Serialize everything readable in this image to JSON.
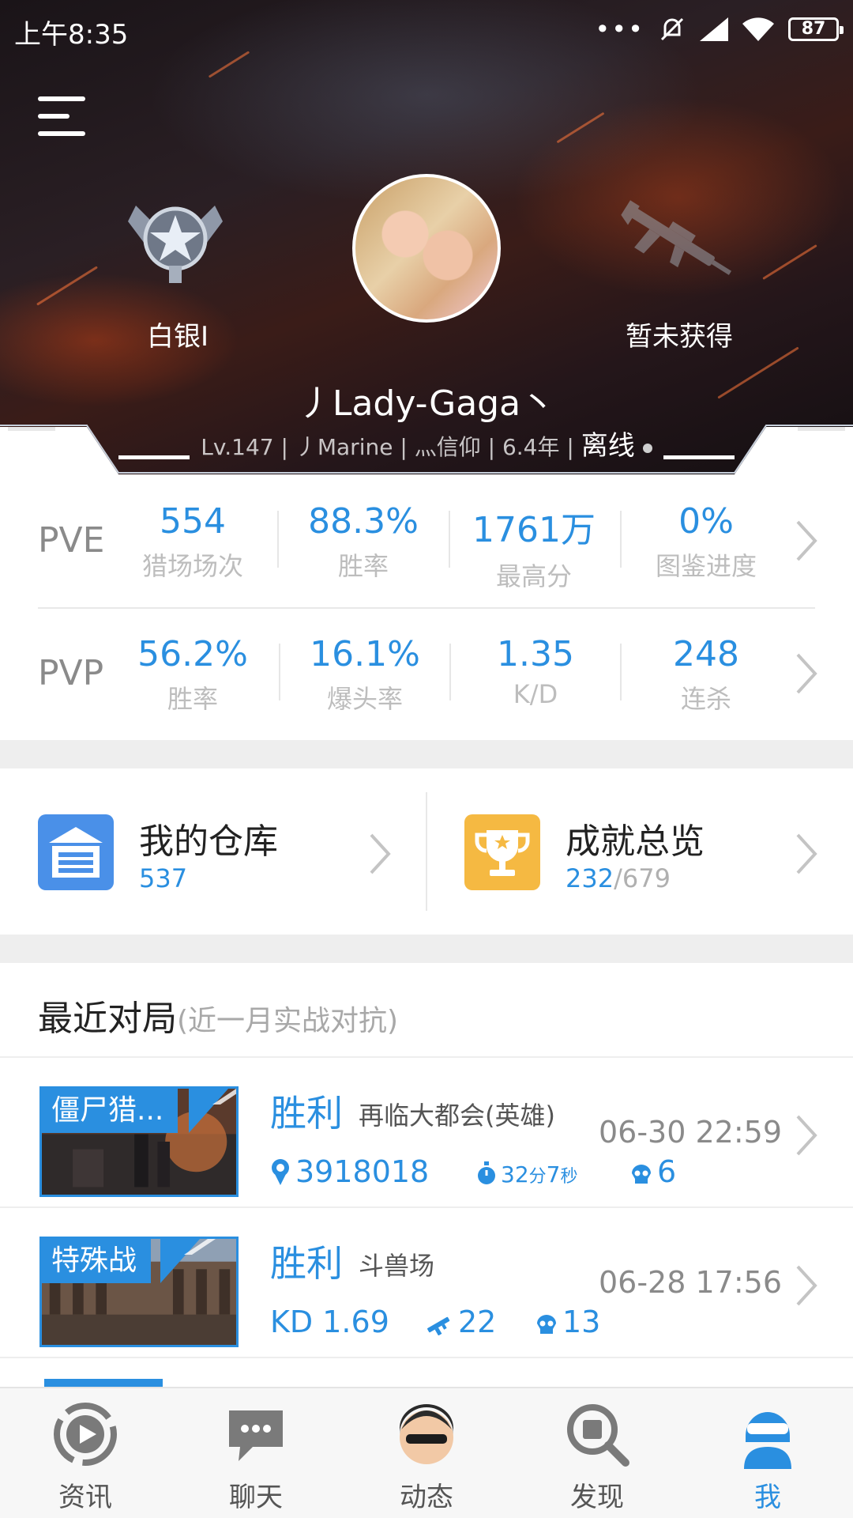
{
  "status_bar": {
    "time": "上午8:35",
    "battery": "87"
  },
  "profile": {
    "rank_label": "白银I",
    "weapon_label": "暂未获得",
    "nickname": "丿Lady-Gaga丶",
    "info": {
      "level": "Lv.147",
      "tag": "丿Marine",
      "clan": "灬信仰",
      "years": "6.4年",
      "status": "离线"
    }
  },
  "stats": {
    "pve": {
      "mode": "PVE",
      "items": [
        {
          "value": "554",
          "label": "猎场场次"
        },
        {
          "value": "88.3%",
          "label": "胜率"
        },
        {
          "value": "1761万",
          "label": "最高分"
        },
        {
          "value": "0%",
          "label": "图鉴进度"
        }
      ]
    },
    "pvp": {
      "mode": "PVP",
      "items": [
        {
          "value": "56.2%",
          "label": "胜率"
        },
        {
          "value": "16.1%",
          "label": "爆头率"
        },
        {
          "value": "1.35",
          "label": "K/D"
        },
        {
          "value": "248",
          "label": "连杀"
        }
      ]
    }
  },
  "shortcuts": {
    "warehouse": {
      "title": "我的仓库",
      "count": "537",
      "icon": "warehouse-icon",
      "color": "#4a90e8"
    },
    "achievements": {
      "title": "成就总览",
      "done": "232",
      "total": "/679",
      "icon": "trophy-icon",
      "color": "#f5b942"
    }
  },
  "recent": {
    "title": "最近对局",
    "subtitle": "(近一月实战对抗)",
    "matches": [
      {
        "mode": "僵尸猎...",
        "result": "胜利",
        "map": "再临大都会(英雄)",
        "time": "06-30 22:59",
        "score": "3918018",
        "duration_value": "32",
        "duration_unit1": "分",
        "duration_value2": "7",
        "duration_unit2": "秒",
        "kills": "6"
      },
      {
        "mode": "特殊战",
        "result": "胜利",
        "map": "斗兽场",
        "time": "06-28 17:56",
        "kd": "KD 1.69",
        "hits": "22",
        "kills": "13"
      }
    ]
  },
  "nav": {
    "items": [
      {
        "label": "资讯",
        "icon": "news-icon"
      },
      {
        "label": "聊天",
        "icon": "chat-icon"
      },
      {
        "label": "动态",
        "icon": "feed-icon"
      },
      {
        "label": "发现",
        "icon": "discover-icon"
      },
      {
        "label": "我",
        "icon": "me-icon"
      }
    ],
    "active_color": "#2a8fe0"
  },
  "colors": {
    "accent": "#2a8fe0",
    "gold": "#f5b942"
  }
}
